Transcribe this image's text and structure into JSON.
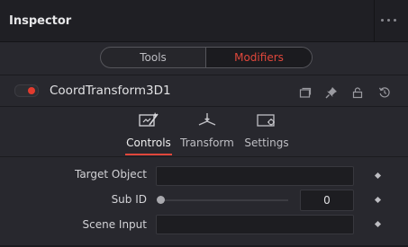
{
  "panel": {
    "title": "Inspector",
    "menu_icon": "more-horizontal-icon"
  },
  "segmented": {
    "tools_label": "Tools",
    "modifiers_label": "Modifiers",
    "active": "Modifiers",
    "accent_color": "#e0473b"
  },
  "node": {
    "name": "CoordTransform3D1",
    "enabled": true,
    "toggle_color": "#e23b2e",
    "icons": [
      "versions-icon",
      "pin-icon",
      "lock-icon",
      "reset-icon"
    ]
  },
  "tabs": [
    {
      "label": "Controls",
      "icon": "controls-icon",
      "active": true
    },
    {
      "label": "Transform",
      "icon": "transform-icon",
      "active": false
    },
    {
      "label": "Settings",
      "icon": "settings-icon",
      "active": false
    }
  ],
  "fields": {
    "target_object": {
      "label": "Target Object",
      "value": ""
    },
    "sub_id": {
      "label": "Sub ID",
      "value": "0",
      "slider_position": 0
    },
    "scene_input": {
      "label": "Scene Input",
      "value": ""
    }
  }
}
